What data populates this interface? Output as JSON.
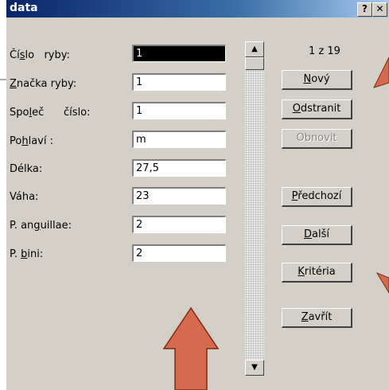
{
  "window": {
    "title": "data",
    "help_btn": "?",
    "close_btn": "✕"
  },
  "record_counter": "1 z 19",
  "fields": [
    {
      "label_a": "Čí",
      "label_u": "s",
      "label_b": "lo   ryby:",
      "value": "1"
    },
    {
      "label_a": "",
      "label_u": "Z",
      "label_b": "načka ryby:",
      "value": "1"
    },
    {
      "label_a": "Spo",
      "label_u": "l",
      "label_b": "eč      číslo:",
      "value": "1"
    },
    {
      "label_a": "Po",
      "label_u": "h",
      "label_b": "laví :",
      "value": "m"
    },
    {
      "label_a": "Délka:",
      "label_u": "",
      "label_b": "",
      "value": "27,5"
    },
    {
      "label_a": "Váha:",
      "label_u": "",
      "label_b": "",
      "value": "23"
    },
    {
      "label_a": "P. an",
      "label_u": "g",
      "label_b": "uillae:",
      "value": "2"
    },
    {
      "label_a": "P. ",
      "label_u": "b",
      "label_b": "ini:",
      "value": "2"
    }
  ],
  "buttons": {
    "new": {
      "pre": "",
      "u": "N",
      "post": "ový"
    },
    "delete": {
      "pre": "",
      "u": "O",
      "post": "dstranit"
    },
    "restore": {
      "pre": "Obnovit",
      "u": "",
      "post": ""
    },
    "previous": {
      "pre": "",
      "u": "P",
      "post": "ředchozí"
    },
    "next": {
      "pre": "",
      "u": "D",
      "post": "alší"
    },
    "criteria": {
      "pre": "",
      "u": "K",
      "post": "ritéria"
    },
    "close": {
      "pre": "",
      "u": "Z",
      "post": "avřít"
    }
  },
  "annotation_color": "#d66a4e",
  "titlebar_color": "#0a246a"
}
